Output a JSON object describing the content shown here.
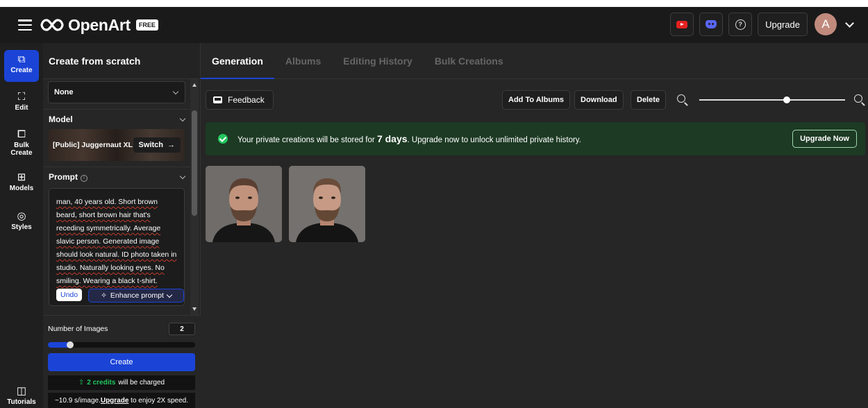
{
  "app": {
    "brand": "OpenArt",
    "plan_badge": "FREE",
    "upgrade_label": "Upgrade",
    "avatar_initial": "A"
  },
  "nav": {
    "create": "Create",
    "edit": "Edit",
    "bulk_create": "Bulk Create",
    "models": "Models",
    "styles": "Styles",
    "tutorials": "Tutorials"
  },
  "panel": {
    "title": "Create from scratch",
    "style_select": "None",
    "model_section": "Model",
    "model_name": "[Public] Juggernaut XL",
    "switch_label": "Switch",
    "prompt_section": "Prompt",
    "prompt_text": "man, 40 years old. Short brown beard, short brown hair that's receding symmetrically. Average slavic person. Generated image should look natural. ID photo taken in studio. Naturally looking eyes. No smiling. Wearing a black t-shirt.",
    "undo_label": "Undo",
    "enhance_label": "Enhance prompt",
    "num_images_label": "Number of Images",
    "num_images_value": "2",
    "num_images_fraction": 0.15,
    "create_label": "Create",
    "credits_highlight": "2 credits",
    "credits_rest": "will be charged",
    "speed_prefix": "~10.9 s/image.",
    "speed_link": "Upgrade",
    "speed_suffix": " to enjoy 2X speed."
  },
  "main": {
    "tabs": [
      "Generation",
      "Albums",
      "Editing History",
      "Bulk Creations"
    ],
    "active_tab": 0,
    "feedback_label": "Feedback",
    "add_to_albums": "Add To Albums",
    "download": "Download",
    "delete": "Delete",
    "zoom_fraction": 0.6,
    "banner_prefix": "Your private creations will be stored for ",
    "banner_bold": "7 days",
    "banner_suffix": ". Upgrade now to unlock unlimited private history.",
    "upgrade_now": "Upgrade Now"
  },
  "colors": {
    "accent": "#1b44d7",
    "banner_bg": "#1d3a24",
    "success": "#22c55e"
  }
}
